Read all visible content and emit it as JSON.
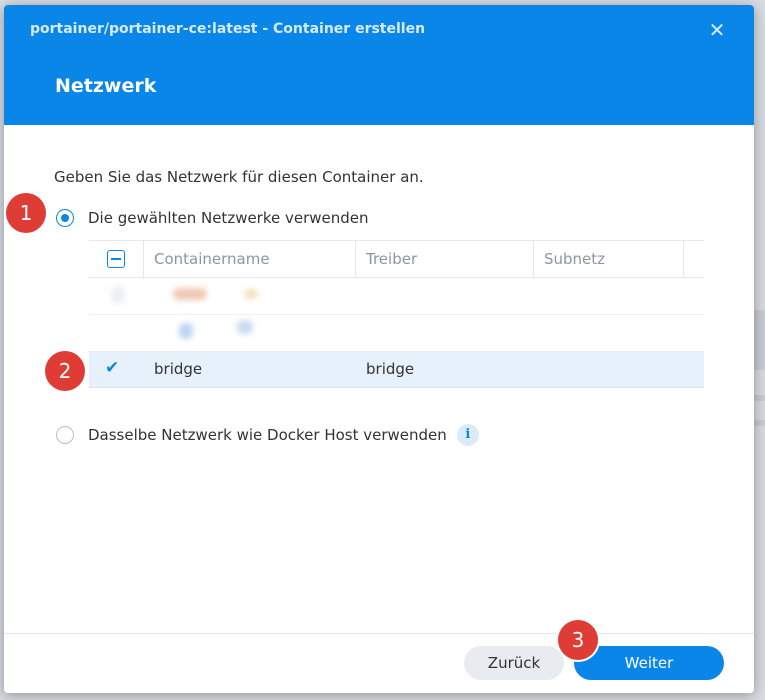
{
  "dialog": {
    "window_title": "portainer/portainer-ce:latest - Container erstellen",
    "close_icon": "close-icon",
    "step_title": "Netzwerk"
  },
  "content": {
    "description": "Geben Sie das Netzwerk für diesen Container an.",
    "option_selected_networks": {
      "label": "Die gewählten Netzwerke verwenden",
      "checked": true
    },
    "option_host_network": {
      "label": "Dasselbe Netzwerk wie Docker Host verwenden",
      "checked": false,
      "info_icon": "info-icon",
      "info_glyph": "i"
    },
    "table": {
      "columns": [
        "Containername",
        "Treiber",
        "Subnetz"
      ],
      "header_checkbox_state": "partial",
      "rows": [
        {
          "name": "bridge",
          "driver": "bridge",
          "subnet": "",
          "checked": true
        }
      ]
    }
  },
  "footer": {
    "back_label": "Zurück",
    "next_label": "Weiter"
  },
  "annotations": {
    "markers": [
      "1",
      "2",
      "3"
    ],
    "marker_color": "#e03c36"
  },
  "colors": {
    "accent": "#0a86e8",
    "selected_row": "#e6f1fc"
  }
}
